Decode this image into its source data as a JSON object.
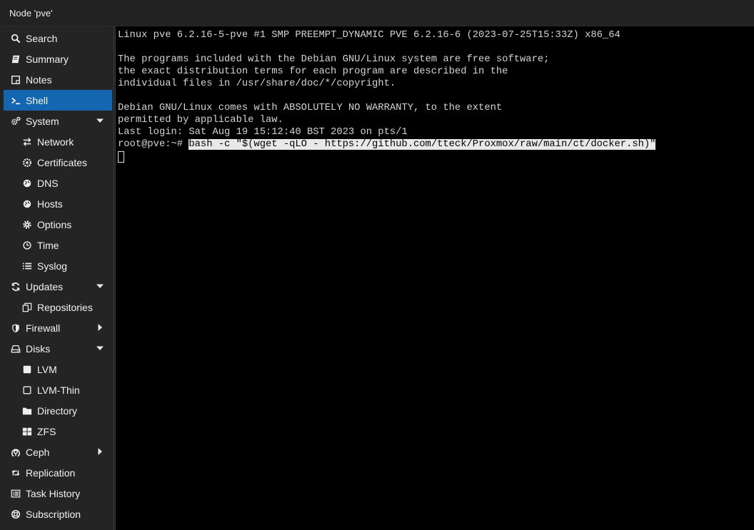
{
  "window": {
    "title": "Node 'pve'"
  },
  "sidebar": {
    "items": [
      {
        "label": "Search",
        "icon": "search-icon",
        "level": 0
      },
      {
        "label": "Summary",
        "icon": "book-icon",
        "level": 0
      },
      {
        "label": "Notes",
        "icon": "note-icon",
        "level": 0
      },
      {
        "label": "Shell",
        "icon": "terminal-icon",
        "level": 0,
        "active": true
      },
      {
        "label": "System",
        "icon": "cogs-icon",
        "level": 0,
        "caret": "down"
      },
      {
        "label": "Network",
        "icon": "exchange-icon",
        "level": 1
      },
      {
        "label": "Certificates",
        "icon": "certificate-icon",
        "level": 1
      },
      {
        "label": "DNS",
        "icon": "globe-icon",
        "level": 1
      },
      {
        "label": "Hosts",
        "icon": "globe-icon",
        "level": 1
      },
      {
        "label": "Options",
        "icon": "gear-icon",
        "level": 1
      },
      {
        "label": "Time",
        "icon": "clock-icon",
        "level": 1
      },
      {
        "label": "Syslog",
        "icon": "list-icon",
        "level": 1
      },
      {
        "label": "Updates",
        "icon": "refresh-icon",
        "level": 0,
        "caret": "down"
      },
      {
        "label": "Repositories",
        "icon": "repositories-icon",
        "level": 1
      },
      {
        "label": "Firewall",
        "icon": "shield-icon",
        "level": 0,
        "caret": "right"
      },
      {
        "label": "Disks",
        "icon": "hdd-icon",
        "level": 0,
        "caret": "down"
      },
      {
        "label": "LVM",
        "icon": "filled-square-icon",
        "level": 1
      },
      {
        "label": "LVM-Thin",
        "icon": "square-outline-icon",
        "level": 1
      },
      {
        "label": "Directory",
        "icon": "folder-icon",
        "level": 1
      },
      {
        "label": "ZFS",
        "icon": "grid-icon",
        "level": 1
      },
      {
        "label": "Ceph",
        "icon": "ceph-icon",
        "level": 0,
        "caret": "right"
      },
      {
        "label": "Replication",
        "icon": "retweet-icon",
        "level": 0
      },
      {
        "label": "Task History",
        "icon": "list-alt-icon",
        "level": 0
      },
      {
        "label": "Subscription",
        "icon": "support-icon",
        "level": 0
      }
    ]
  },
  "terminal": {
    "lines": [
      "Linux pve 6.2.16-5-pve #1 SMP PREEMPT_DYNAMIC PVE 6.2.16-6 (2023-07-25T15:33Z) x86_64",
      "",
      "The programs included with the Debian GNU/Linux system are free software;",
      "the exact distribution terms for each program are described in the",
      "individual files in /usr/share/doc/*/copyright.",
      "",
      "Debian GNU/Linux comes with ABSOLUTELY NO WARRANTY, to the extent",
      "permitted by applicable law.",
      "Last login: Sat Aug 19 15:12:40 BST 2023 on pts/1"
    ],
    "prompt": "root@pve:~# ",
    "command": "bash -c \"$(wget -qLO - https://github.com/tteck/Proxmox/raw/main/ct/docker.sh)\""
  }
}
